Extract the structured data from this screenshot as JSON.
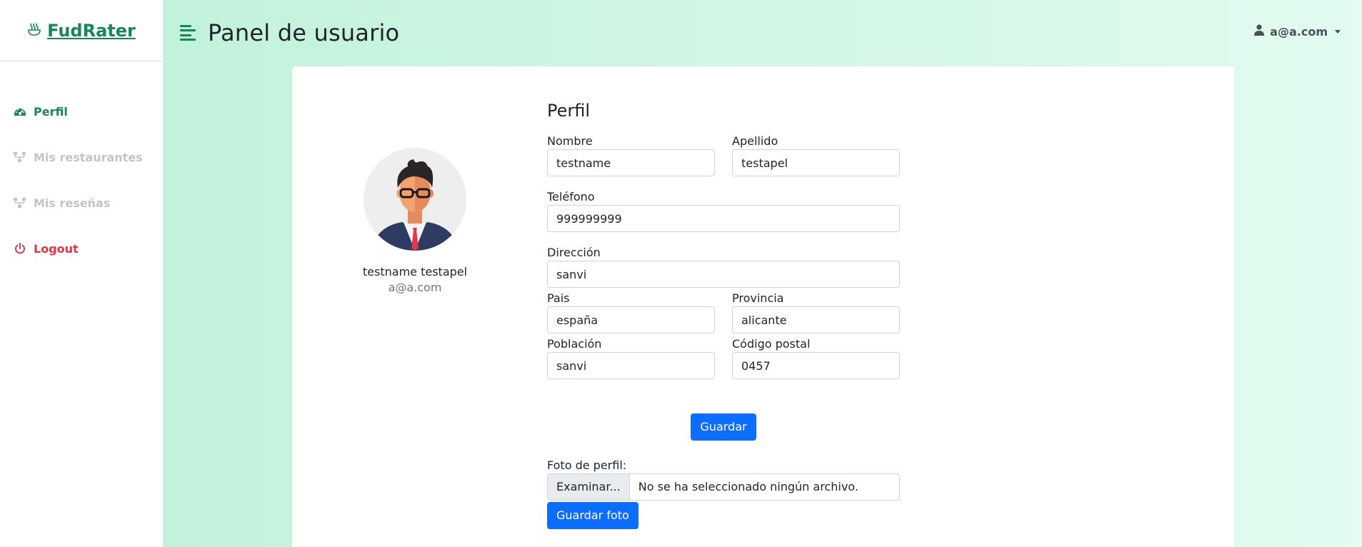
{
  "brand": {
    "name": "FudRater",
    "icon": "bowl-steam-icon"
  },
  "sidebar": {
    "items": [
      {
        "label": "Perfil",
        "icon": "gauge-icon",
        "state": "active"
      },
      {
        "label": "Mis restaurantes",
        "icon": "sitemap-icon",
        "state": "muted"
      },
      {
        "label": "Mis reseñas",
        "icon": "sitemap-icon",
        "state": "muted"
      },
      {
        "label": "Logout",
        "icon": "power-icon",
        "state": "danger"
      }
    ]
  },
  "header": {
    "title": "Panel de usuario",
    "user_email": "a@a.com"
  },
  "profile": {
    "full_name": "testname testapel",
    "email": "a@a.com"
  },
  "form": {
    "title": "Perfil",
    "nombre_label": "Nombre",
    "nombre_value": "testname",
    "apellido_label": "Apellido",
    "apellido_value": "testapel",
    "telefono_label": "Teléfono",
    "telefono_value": "999999999",
    "direccion_label": "Dirección",
    "direccion_value": "sanvi",
    "pais_label": "Pais",
    "pais_value": "españa",
    "provincia_label": "Provincia",
    "provincia_value": "alicante",
    "poblacion_label": "Población",
    "poblacion_value": "sanvi",
    "codigo_postal_label": "Código postal",
    "codigo_postal_value": "0457",
    "save_label": "Guardar",
    "photo_label": "Foto de perfil:",
    "browse_label": "Examinar...",
    "no_file_text": "No se ha seleccionado ningún archivo.",
    "save_photo_label": "Guardar foto"
  },
  "colors": {
    "accent": "#198754",
    "primary": "#0d6efd",
    "danger": "#dc3545",
    "muted": "#c1c4c8",
    "background": "#c2f2dc"
  }
}
